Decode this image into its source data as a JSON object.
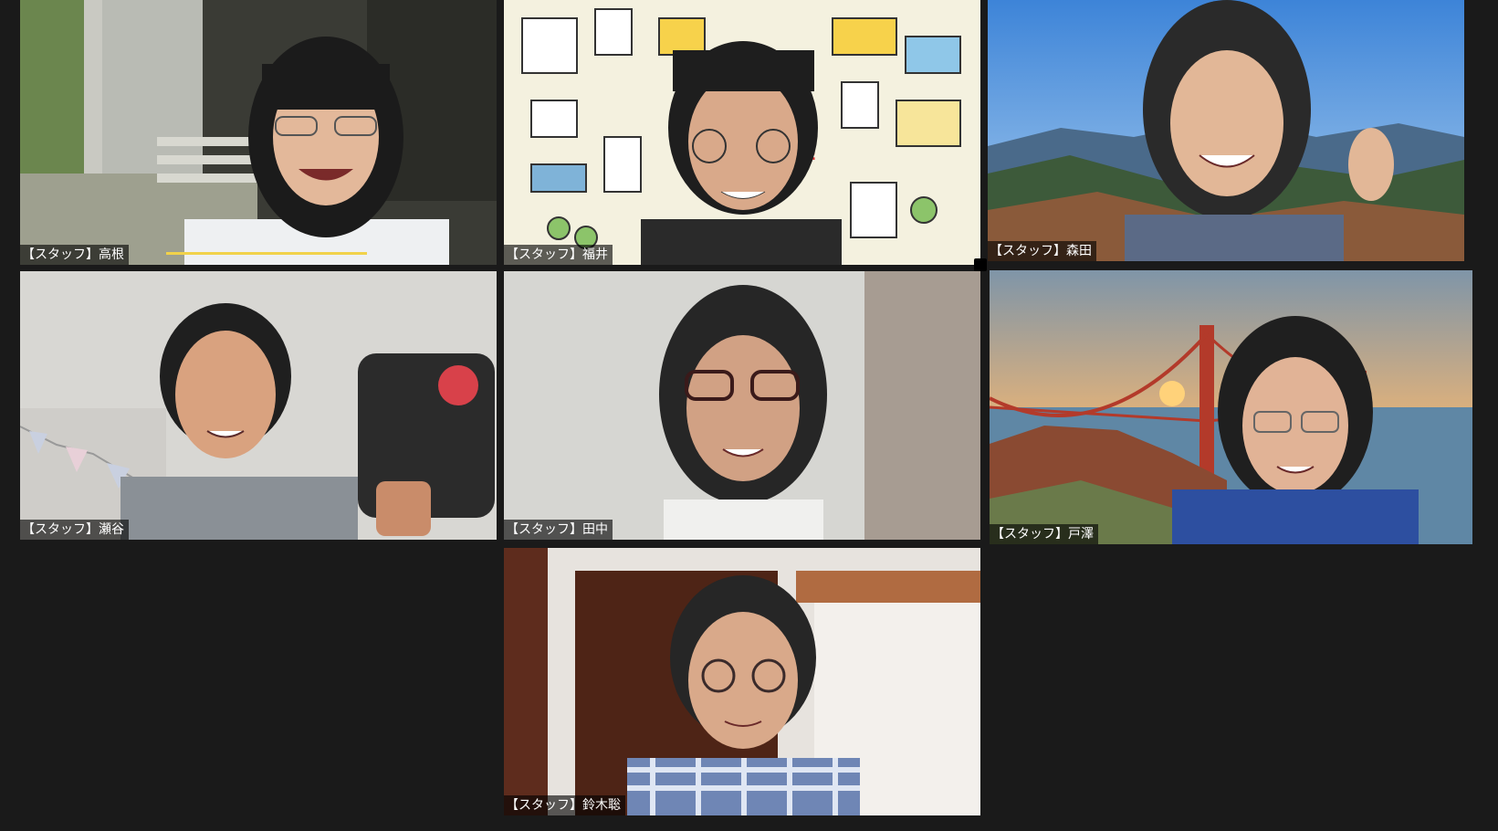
{
  "meeting": {
    "participants": [
      {
        "name": "【スタッフ】高根"
      },
      {
        "name": "【スタッフ】福井"
      },
      {
        "name": "【スタッフ】森田"
      },
      {
        "name": "【スタッフ】瀬谷"
      },
      {
        "name": "【スタッフ】田中"
      },
      {
        "name": "【スタッフ】戸澤"
      },
      {
        "name": "【スタッフ】鈴木聡"
      }
    ]
  }
}
